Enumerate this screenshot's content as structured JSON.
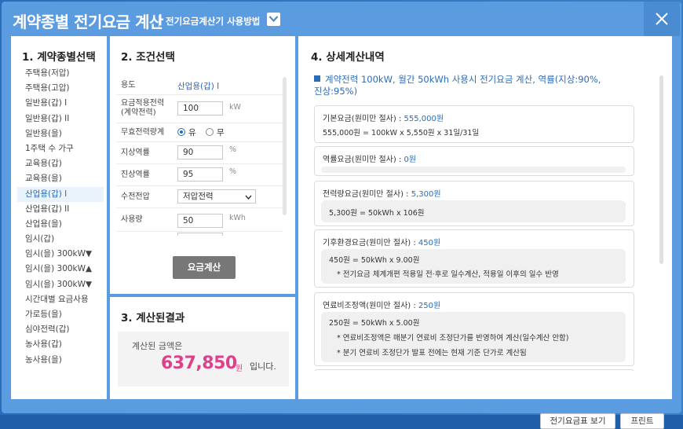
{
  "title": "계약종별 전기요금 계산",
  "guide_link": "전기요금계산기 사용방법",
  "panels": {
    "p1_title": "1. 계약종별선택",
    "p2_title": "2. 조건선택",
    "p3_title": "3. 계산된결과",
    "p4_title": "4. 상세계산내역"
  },
  "contract_types": [
    "주택용(저압)",
    "주택용(고압)",
    "일반용(갑) I",
    "일반용(갑) II",
    "일반용(을)",
    "1주택 수 가구",
    "교육용(갑)",
    "교육용(을)",
    "산업용(갑) I",
    "산업용(갑) II",
    "산업용(을)",
    "임시(갑)",
    "임시(을) 300kW▼",
    "임시(을) 300kW▲",
    "임시(을) 300kW▼",
    "시간대별 요금사용",
    "가로등(을)",
    "심야전력(갑)",
    "농사용(갑)",
    "농사용(을)"
  ],
  "conditions": {
    "usage_label": "용도",
    "usage_value": "산업용(갑) I",
    "contract_power_label_1": "요금적용전력",
    "contract_power_label_2": "(계약전력)",
    "contract_power_value": "100",
    "contract_power_unit": "kW",
    "reactive_label": "무효전력량계",
    "reactive_yes": "유",
    "reactive_no": "무",
    "lag_label": "지상역률",
    "lag_value": "90",
    "lag_unit": "%",
    "lead_label": "진상역률",
    "lead_value": "95",
    "lead_unit": "%",
    "voltage_label": "수전전압",
    "voltage_value": "저압전력",
    "usage_amount_label": "사용량",
    "usage_amount_value": "50",
    "usage_amount_unit": "kWh",
    "calc_button": "요금계산"
  },
  "result": {
    "label": "계산된 금액은",
    "amount": "637,850",
    "won": "원",
    "tail": "입니다."
  },
  "detail": {
    "headline_line1": "계약전력 100kW, 월간 50kWh 사용시 전기요금 계산, 역률(지상:90%,",
    "headline_line2": "진상:95%)",
    "base_title": "기본요금(원미만 절사) : ",
    "base_amount": "555,000원",
    "base_formula": "555,000원 = 100kW x 5,550원 x 31일/31일",
    "pf_title": "역률요금(원미만 절사) : ",
    "pf_amount": "0원",
    "energy_title": "전력량요금(원미만 절사) : ",
    "energy_amount": "5,300원",
    "energy_formula": "5,300원 = 50kWh x 106원",
    "climate_title": "기후환경요금(원미만 절사) : ",
    "climate_amount": "450원",
    "climate_formula": "450원 = 50kWh x 9.00원",
    "climate_note": "* 전기요금 체계개편 적용일 전·후로 일수계산, 적용일 이후의 일수 반영",
    "fuel_title": "연료비조정액(원미만 절사) : ",
    "fuel_amount": "250원",
    "fuel_formula": "250원 = 50kWh x 5.00원",
    "fuel_note1": "* 연료비조정액은 매분기 연료비 조정단가를 반영하여 계산(일수계산 안함)",
    "fuel_note2": "* 분기 연료비 조정단가 발표 전에는 현재 기준 단가로 계산됨"
  },
  "buttons": {
    "rate_table": "전기요금표 보기",
    "print": "프린트"
  }
}
